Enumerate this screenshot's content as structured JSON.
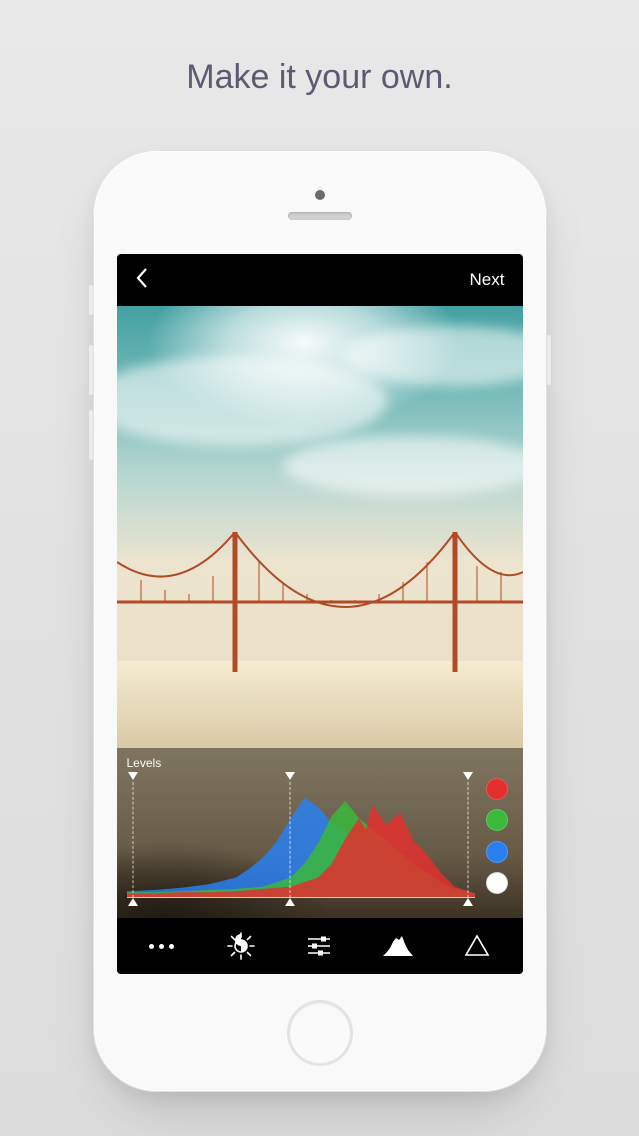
{
  "headline": "Make it your own.",
  "topbar": {
    "next_label": "Next"
  },
  "levels": {
    "label": "Levels",
    "top_markers_pct": [
      2,
      47,
      98
    ],
    "bottom_markers_pct": [
      2,
      47,
      98
    ],
    "channels": [
      {
        "name": "red",
        "color": "#e32f2f"
      },
      {
        "name": "green",
        "color": "#3bb93b"
      },
      {
        "name": "blue",
        "color": "#2a7ff0"
      },
      {
        "name": "white",
        "color": "#ffffff"
      }
    ]
  },
  "toolbar": {
    "items": [
      {
        "name": "more",
        "icon": "more-icon"
      },
      {
        "name": "brightness",
        "icon": "brightness-icon"
      },
      {
        "name": "adjust",
        "icon": "sliders-icon"
      },
      {
        "name": "histogram",
        "icon": "histogram-icon"
      },
      {
        "name": "sharpen",
        "icon": "sharpen-icon"
      }
    ]
  },
  "chart_data": {
    "type": "area",
    "title": "Levels",
    "xlabel": "",
    "ylabel": "",
    "xlim": [
      0,
      255
    ],
    "ylim": [
      0,
      100
    ],
    "series": [
      {
        "name": "red",
        "color": "#e32f2f",
        "x": [
          0,
          20,
          40,
          60,
          80,
          100,
          120,
          140,
          150,
          160,
          170,
          175,
          180,
          190,
          200,
          210,
          220,
          230,
          240,
          255
        ],
        "values": [
          4,
          4,
          5,
          5,
          6,
          8,
          10,
          18,
          30,
          52,
          70,
          60,
          82,
          64,
          75,
          50,
          38,
          22,
          10,
          4
        ]
      },
      {
        "name": "green",
        "color": "#3bb93b",
        "x": [
          0,
          20,
          40,
          60,
          80,
          100,
          120,
          130,
          140,
          150,
          160,
          170,
          180,
          190,
          200,
          210,
          220,
          230,
          240,
          255
        ],
        "values": [
          5,
          5,
          6,
          7,
          8,
          10,
          18,
          30,
          48,
          72,
          85,
          70,
          60,
          50,
          40,
          30,
          22,
          14,
          8,
          4
        ]
      },
      {
        "name": "blue",
        "color": "#2a7ff0",
        "x": [
          0,
          20,
          40,
          60,
          80,
          90,
          100,
          110,
          120,
          130,
          140,
          150,
          160,
          170,
          180,
          190,
          200,
          210,
          230,
          255
        ],
        "values": [
          6,
          7,
          9,
          12,
          18,
          26,
          36,
          50,
          70,
          88,
          80,
          66,
          58,
          50,
          40,
          30,
          22,
          14,
          8,
          4
        ]
      }
    ]
  }
}
